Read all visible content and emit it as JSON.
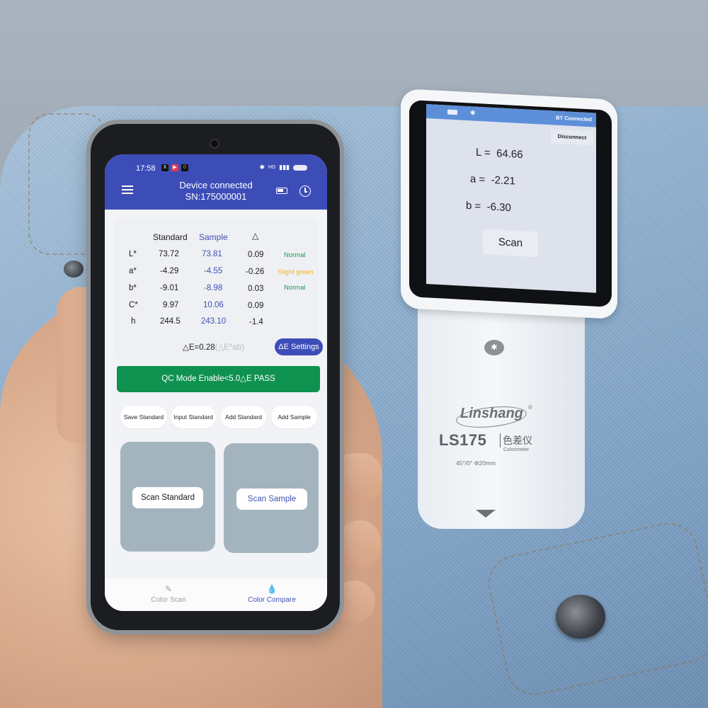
{
  "phone": {
    "status_bar": {
      "time": "17:58",
      "apps": [
        "X",
        "▶",
        "0"
      ],
      "right_icons": [
        "bluetooth-icon",
        "hd-icon",
        "signal-icon",
        "battery-icon"
      ],
      "hd_label": "HD"
    },
    "header": {
      "title": "Device connected",
      "serial": "SN:175000001",
      "icons": [
        "menu-icon",
        "device-battery-icon",
        "history-clock-icon"
      ]
    },
    "table": {
      "columns": [
        "",
        "Standard",
        "Sample",
        "△",
        ""
      ],
      "rows": [
        {
          "label": "L*",
          "standard": "73.72",
          "sample": "73.81",
          "delta": "0.09",
          "status": "Normal",
          "status_color": "#1e9a5a"
        },
        {
          "label": "a*",
          "standard": "-4.29",
          "sample": "-4.55",
          "delta": "-0.26",
          "status": "Slight green",
          "status_color": "#f0b429"
        },
        {
          "label": "b*",
          "standard": "-9.01",
          "sample": "-8.98",
          "delta": "0.03",
          "status": "Normal",
          "status_color": "#1e9a5a"
        },
        {
          "label": "C*",
          "standard": "9.97",
          "sample": "10.06",
          "delta": "0.09",
          "status": ""
        },
        {
          "label": "h",
          "standard": "244.5",
          "sample": "243.10",
          "delta": "-1.4",
          "status": ""
        }
      ]
    },
    "delta_e": {
      "value_text": "△E=0.28",
      "formula_text": "(△E*ab)",
      "settings_label": "ΔE Settings"
    },
    "qc_bar": {
      "text": "QC Mode Enable<5.0△E   PASS",
      "color": "#0f9150"
    },
    "actions": [
      "Save Standard",
      "Input Standard",
      "Add Standard",
      "Add Sample"
    ],
    "swatches": {
      "standard_label": "Scan Standard",
      "sample_label": "Scan Sample",
      "standard_color": "#a3b4bf",
      "sample_color": "#a3b4bf"
    },
    "bottom_nav": [
      {
        "label": "Color Scan",
        "icon": "eyedropper-icon",
        "active": false
      },
      {
        "label": "Color Compare",
        "icon": "droplet-icon",
        "active": true
      }
    ],
    "accent_color": "#3d4db8"
  },
  "colorimeter": {
    "status": "BT Connected",
    "disconnect_label": "Disconnect",
    "readings": [
      {
        "label": "L =",
        "value": "64.66"
      },
      {
        "label": "a =",
        "value": "-2.21"
      },
      {
        "label": "b =",
        "value": "-6.30"
      }
    ],
    "scan_label": "Scan",
    "brand": "Linshang",
    "registered": "®",
    "model": "LS175",
    "model_cn": "色差仪",
    "model_en": "Colorimeter",
    "spec": "45°/0°  Φ20mm"
  }
}
